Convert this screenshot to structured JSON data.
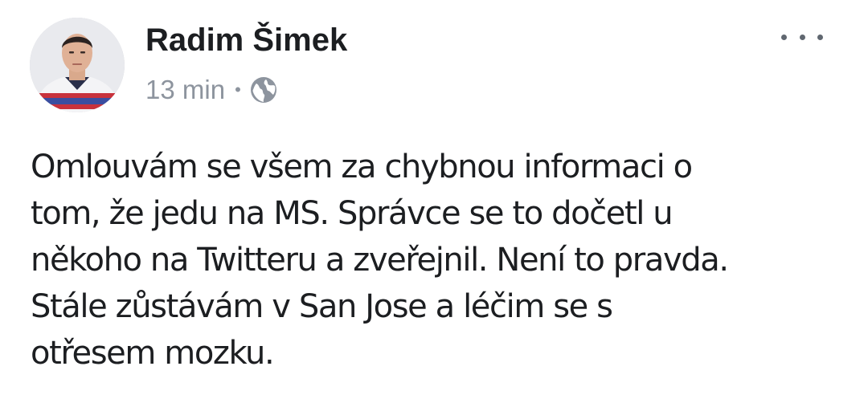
{
  "post": {
    "author": "Radim Šimek",
    "time": "13 min",
    "separator": "•",
    "audience_icon": "globe-icon",
    "more_icon": "more-options-icon",
    "text_lines": [
      "Omlouvám se všem za chybnou informaci o",
      "tom, že jedu na MS. Správce se to dočetl u",
      "někoho na Twitteru a zveřejnil. Není to pravda.",
      "Stále zůstávám v San Jose a léčim se s",
      "otřesem mozku."
    ]
  },
  "colors": {
    "text": "#1c1e21",
    "secondary": "#8d949e",
    "icon": "#606770",
    "background": "#ffffff"
  }
}
